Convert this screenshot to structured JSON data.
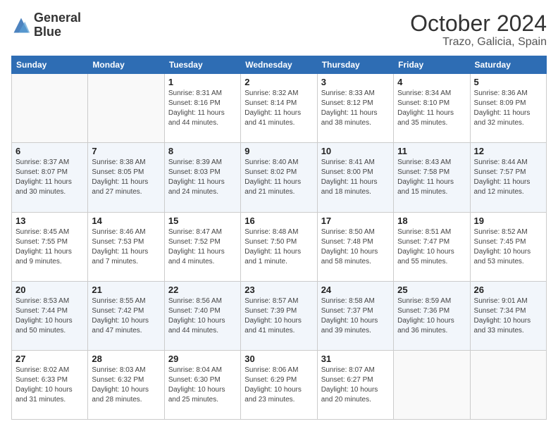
{
  "logo": {
    "line1": "General",
    "line2": "Blue"
  },
  "header": {
    "month": "October 2024",
    "location": "Trazo, Galicia, Spain"
  },
  "weekdays": [
    "Sunday",
    "Monday",
    "Tuesday",
    "Wednesday",
    "Thursday",
    "Friday",
    "Saturday"
  ],
  "weeks": [
    [
      {
        "day": "",
        "sunrise": "",
        "sunset": "",
        "daylight": ""
      },
      {
        "day": "",
        "sunrise": "",
        "sunset": "",
        "daylight": ""
      },
      {
        "day": "1",
        "sunrise": "Sunrise: 8:31 AM",
        "sunset": "Sunset: 8:16 PM",
        "daylight": "Daylight: 11 hours and 44 minutes."
      },
      {
        "day": "2",
        "sunrise": "Sunrise: 8:32 AM",
        "sunset": "Sunset: 8:14 PM",
        "daylight": "Daylight: 11 hours and 41 minutes."
      },
      {
        "day": "3",
        "sunrise": "Sunrise: 8:33 AM",
        "sunset": "Sunset: 8:12 PM",
        "daylight": "Daylight: 11 hours and 38 minutes."
      },
      {
        "day": "4",
        "sunrise": "Sunrise: 8:34 AM",
        "sunset": "Sunset: 8:10 PM",
        "daylight": "Daylight: 11 hours and 35 minutes."
      },
      {
        "day": "5",
        "sunrise": "Sunrise: 8:36 AM",
        "sunset": "Sunset: 8:09 PM",
        "daylight": "Daylight: 11 hours and 32 minutes."
      }
    ],
    [
      {
        "day": "6",
        "sunrise": "Sunrise: 8:37 AM",
        "sunset": "Sunset: 8:07 PM",
        "daylight": "Daylight: 11 hours and 30 minutes."
      },
      {
        "day": "7",
        "sunrise": "Sunrise: 8:38 AM",
        "sunset": "Sunset: 8:05 PM",
        "daylight": "Daylight: 11 hours and 27 minutes."
      },
      {
        "day": "8",
        "sunrise": "Sunrise: 8:39 AM",
        "sunset": "Sunset: 8:03 PM",
        "daylight": "Daylight: 11 hours and 24 minutes."
      },
      {
        "day": "9",
        "sunrise": "Sunrise: 8:40 AM",
        "sunset": "Sunset: 8:02 PM",
        "daylight": "Daylight: 11 hours and 21 minutes."
      },
      {
        "day": "10",
        "sunrise": "Sunrise: 8:41 AM",
        "sunset": "Sunset: 8:00 PM",
        "daylight": "Daylight: 11 hours and 18 minutes."
      },
      {
        "day": "11",
        "sunrise": "Sunrise: 8:43 AM",
        "sunset": "Sunset: 7:58 PM",
        "daylight": "Daylight: 11 hours and 15 minutes."
      },
      {
        "day": "12",
        "sunrise": "Sunrise: 8:44 AM",
        "sunset": "Sunset: 7:57 PM",
        "daylight": "Daylight: 11 hours and 12 minutes."
      }
    ],
    [
      {
        "day": "13",
        "sunrise": "Sunrise: 8:45 AM",
        "sunset": "Sunset: 7:55 PM",
        "daylight": "Daylight: 11 hours and 9 minutes."
      },
      {
        "day": "14",
        "sunrise": "Sunrise: 8:46 AM",
        "sunset": "Sunset: 7:53 PM",
        "daylight": "Daylight: 11 hours and 7 minutes."
      },
      {
        "day": "15",
        "sunrise": "Sunrise: 8:47 AM",
        "sunset": "Sunset: 7:52 PM",
        "daylight": "Daylight: 11 hours and 4 minutes."
      },
      {
        "day": "16",
        "sunrise": "Sunrise: 8:48 AM",
        "sunset": "Sunset: 7:50 PM",
        "daylight": "Daylight: 11 hours and 1 minute."
      },
      {
        "day": "17",
        "sunrise": "Sunrise: 8:50 AM",
        "sunset": "Sunset: 7:48 PM",
        "daylight": "Daylight: 10 hours and 58 minutes."
      },
      {
        "day": "18",
        "sunrise": "Sunrise: 8:51 AM",
        "sunset": "Sunset: 7:47 PM",
        "daylight": "Daylight: 10 hours and 55 minutes."
      },
      {
        "day": "19",
        "sunrise": "Sunrise: 8:52 AM",
        "sunset": "Sunset: 7:45 PM",
        "daylight": "Daylight: 10 hours and 53 minutes."
      }
    ],
    [
      {
        "day": "20",
        "sunrise": "Sunrise: 8:53 AM",
        "sunset": "Sunset: 7:44 PM",
        "daylight": "Daylight: 10 hours and 50 minutes."
      },
      {
        "day": "21",
        "sunrise": "Sunrise: 8:55 AM",
        "sunset": "Sunset: 7:42 PM",
        "daylight": "Daylight: 10 hours and 47 minutes."
      },
      {
        "day": "22",
        "sunrise": "Sunrise: 8:56 AM",
        "sunset": "Sunset: 7:40 PM",
        "daylight": "Daylight: 10 hours and 44 minutes."
      },
      {
        "day": "23",
        "sunrise": "Sunrise: 8:57 AM",
        "sunset": "Sunset: 7:39 PM",
        "daylight": "Daylight: 10 hours and 41 minutes."
      },
      {
        "day": "24",
        "sunrise": "Sunrise: 8:58 AM",
        "sunset": "Sunset: 7:37 PM",
        "daylight": "Daylight: 10 hours and 39 minutes."
      },
      {
        "day": "25",
        "sunrise": "Sunrise: 8:59 AM",
        "sunset": "Sunset: 7:36 PM",
        "daylight": "Daylight: 10 hours and 36 minutes."
      },
      {
        "day": "26",
        "sunrise": "Sunrise: 9:01 AM",
        "sunset": "Sunset: 7:34 PM",
        "daylight": "Daylight: 10 hours and 33 minutes."
      }
    ],
    [
      {
        "day": "27",
        "sunrise": "Sunrise: 8:02 AM",
        "sunset": "Sunset: 6:33 PM",
        "daylight": "Daylight: 10 hours and 31 minutes."
      },
      {
        "day": "28",
        "sunrise": "Sunrise: 8:03 AM",
        "sunset": "Sunset: 6:32 PM",
        "daylight": "Daylight: 10 hours and 28 minutes."
      },
      {
        "day": "29",
        "sunrise": "Sunrise: 8:04 AM",
        "sunset": "Sunset: 6:30 PM",
        "daylight": "Daylight: 10 hours and 25 minutes."
      },
      {
        "day": "30",
        "sunrise": "Sunrise: 8:06 AM",
        "sunset": "Sunset: 6:29 PM",
        "daylight": "Daylight: 10 hours and 23 minutes."
      },
      {
        "day": "31",
        "sunrise": "Sunrise: 8:07 AM",
        "sunset": "Sunset: 6:27 PM",
        "daylight": "Daylight: 10 hours and 20 minutes."
      },
      {
        "day": "",
        "sunrise": "",
        "sunset": "",
        "daylight": ""
      },
      {
        "day": "",
        "sunrise": "",
        "sunset": "",
        "daylight": ""
      }
    ]
  ]
}
